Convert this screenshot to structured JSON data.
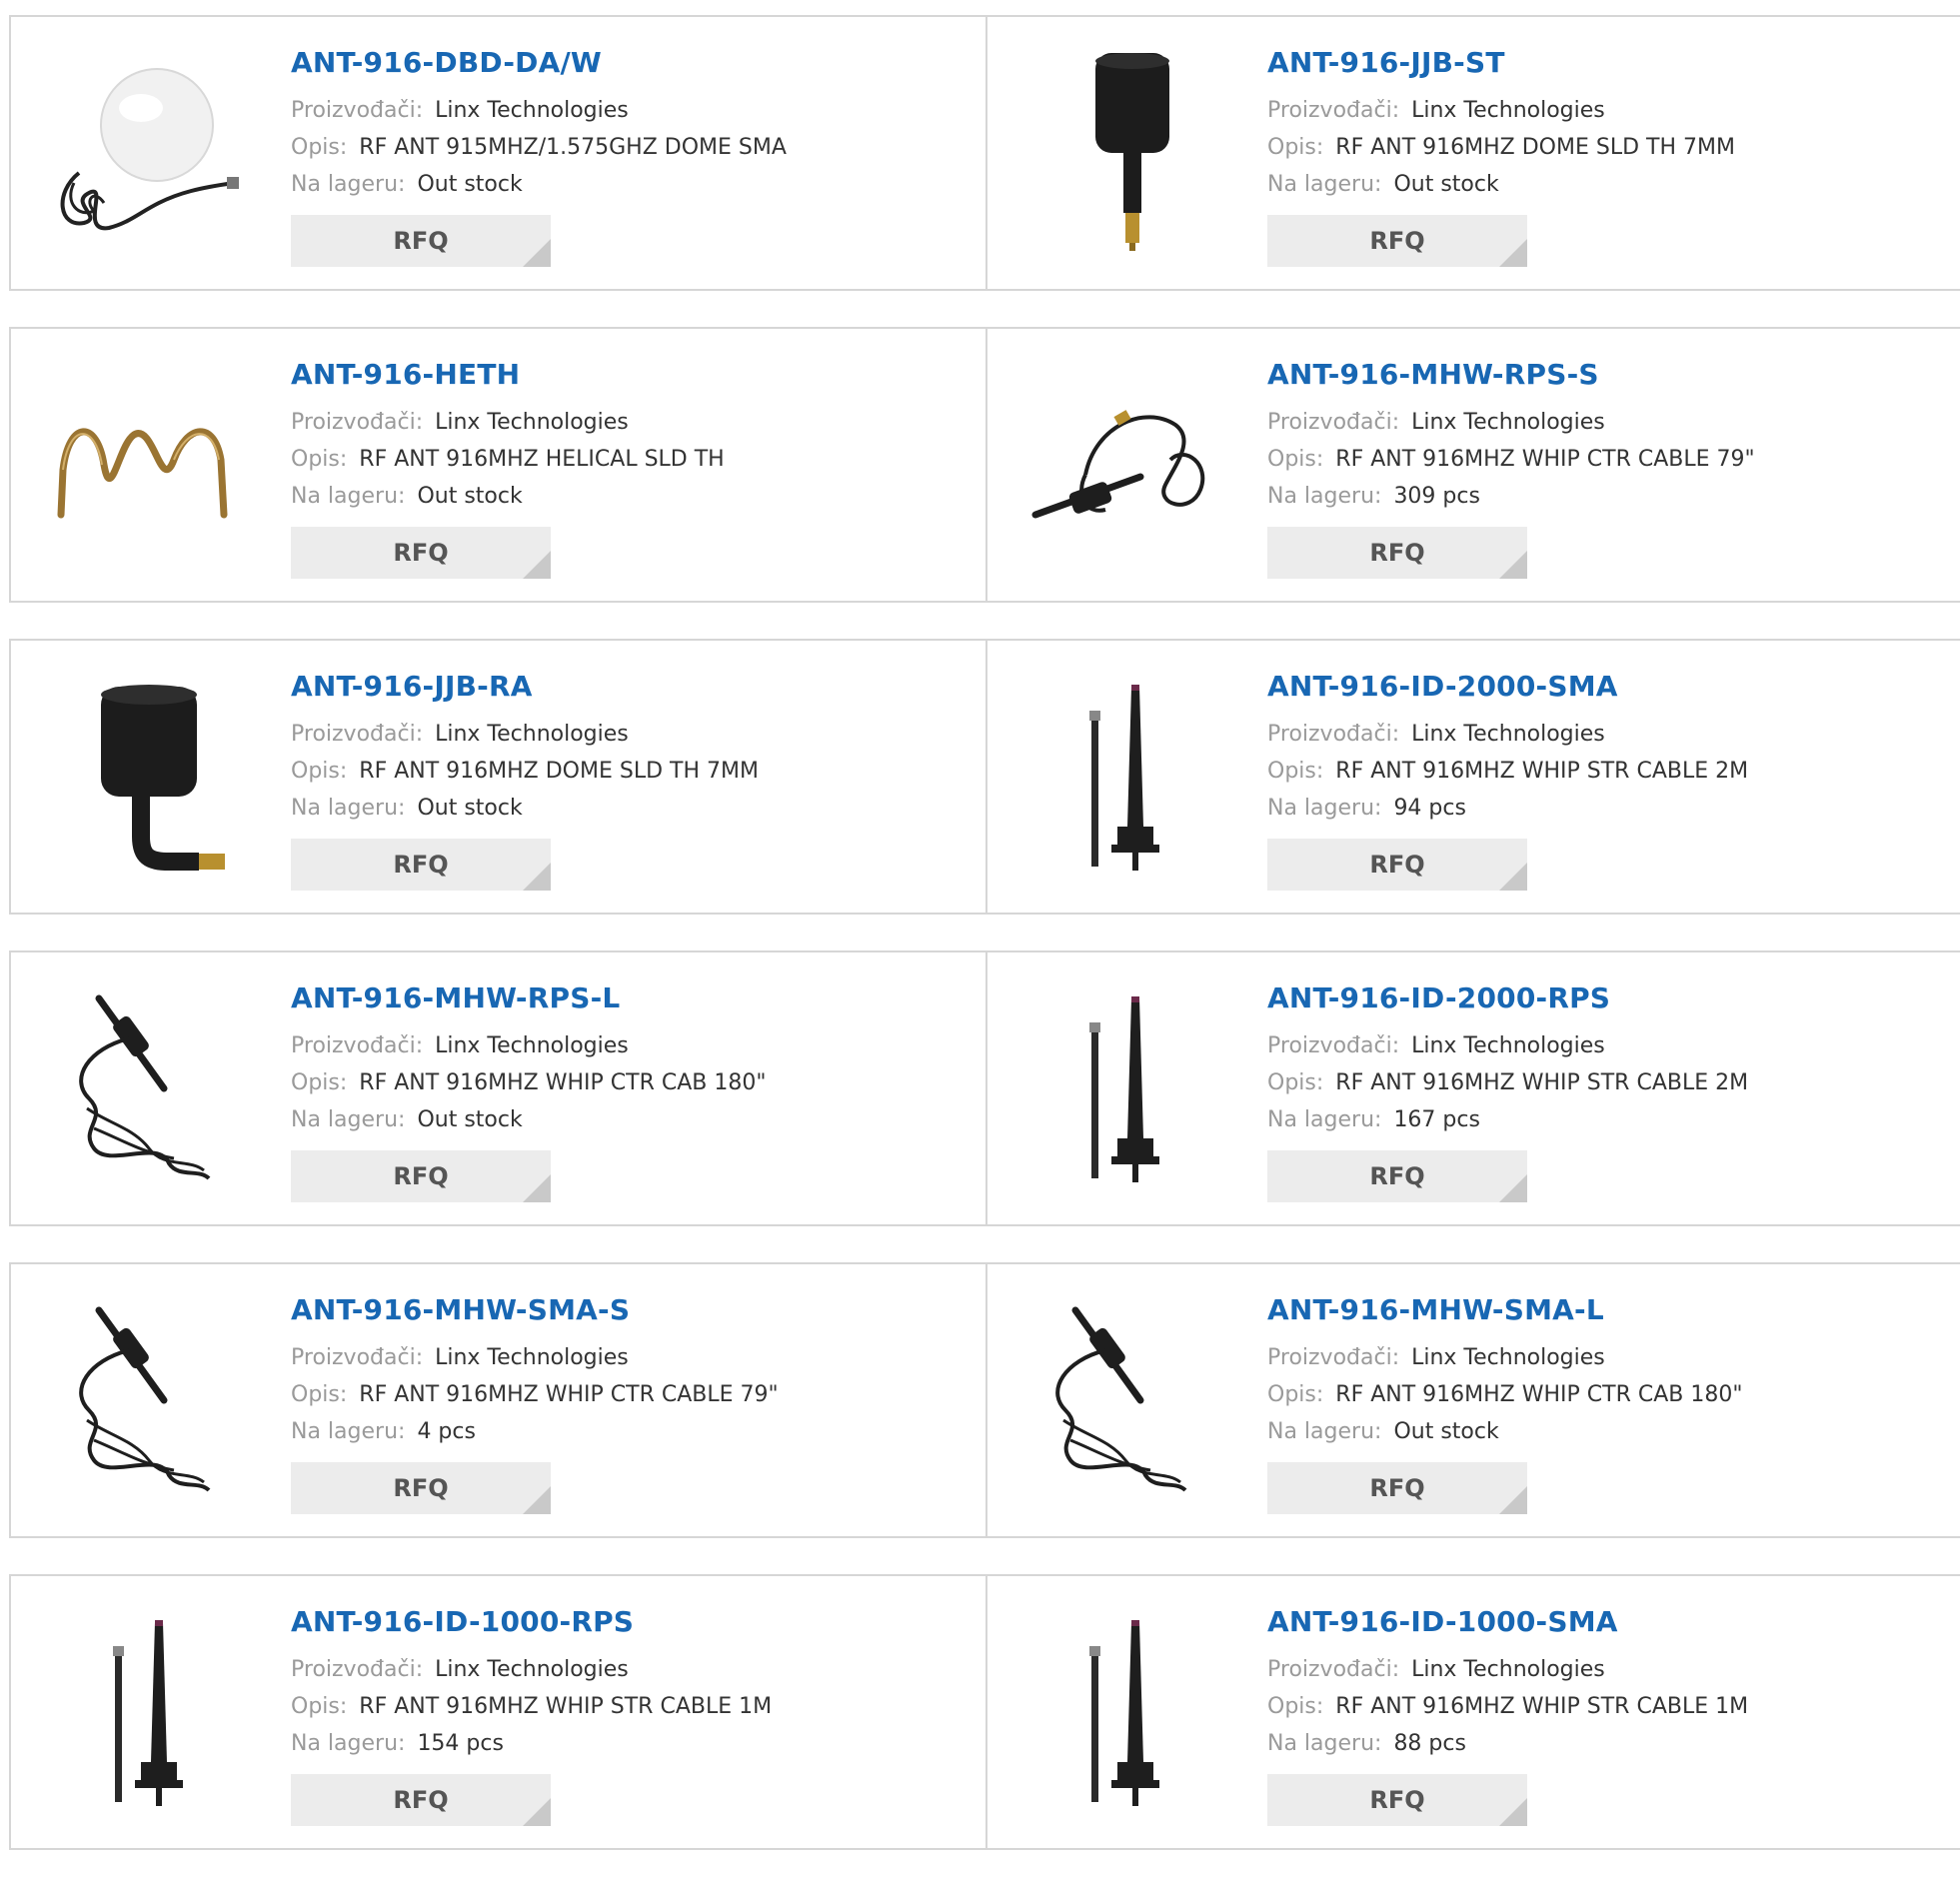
{
  "labels": {
    "manufacturer": "Proizvođači:",
    "description": "Opis:",
    "stock": "Na lageru:",
    "rfq": "RFQ"
  },
  "products": [
    {
      "name": "ANT-916-DBD-DA/W",
      "manufacturer": "Linx Technologies",
      "description": "RF ANT 915MHZ/1.575GHZ DOME SMA",
      "stock": "Out stock",
      "image": "dome-antenna-white"
    },
    {
      "name": "ANT-916-JJB-ST",
      "manufacturer": "Linx Technologies",
      "description": "RF ANT 916MHZ DOME SLD TH 7MM",
      "stock": "Out stock",
      "image": "dome-antenna-straight"
    },
    {
      "name": "ANT-916-HETH",
      "manufacturer": "Linx Technologies",
      "description": "RF ANT 916MHZ HELICAL SLD TH",
      "stock": "Out stock",
      "image": "helical-antenna"
    },
    {
      "name": "ANT-916-MHW-RPS-S",
      "manufacturer": "Linx Technologies",
      "description": "RF ANT 916MHZ WHIP CTR CABLE 79\"",
      "stock": "309 pcs",
      "image": "whip-cable-antenna"
    },
    {
      "name": "ANT-916-JJB-RA",
      "manufacturer": "Linx Technologies",
      "description": "RF ANT 916MHZ DOME SLD TH 7MM",
      "stock": "Out stock",
      "image": "dome-antenna-right-angle"
    },
    {
      "name": "ANT-916-ID-2000-SMA",
      "manufacturer": "Linx Technologies",
      "description": "RF ANT 916MHZ WHIP STR CABLE 2M",
      "stock": "94 pcs",
      "image": "whip-mount-antenna"
    },
    {
      "name": "ANT-916-MHW-RPS-L",
      "manufacturer": "Linx Technologies",
      "description": "RF ANT 916MHZ WHIP CTR CAB 180\"",
      "stock": "Out stock",
      "image": "whip-coil-antenna"
    },
    {
      "name": "ANT-916-ID-2000-RPS",
      "manufacturer": "Linx Technologies",
      "description": "RF ANT 916MHZ WHIP STR CABLE 2M",
      "stock": "167 pcs",
      "image": "whip-mount-antenna"
    },
    {
      "name": "ANT-916-MHW-SMA-S",
      "manufacturer": "Linx Technologies",
      "description": "RF ANT 916MHZ WHIP CTR CABLE 79\"",
      "stock": "4 pcs",
      "image": "whip-coil-antenna"
    },
    {
      "name": "ANT-916-MHW-SMA-L",
      "manufacturer": "Linx Technologies",
      "description": "RF ANT 916MHZ WHIP CTR CAB 180\"",
      "stock": "Out stock",
      "image": "whip-coil-antenna"
    },
    {
      "name": "ANT-916-ID-1000-RPS",
      "manufacturer": "Linx Technologies",
      "description": "RF ANT 916MHZ WHIP STR CABLE 1M",
      "stock": "154 pcs",
      "image": "whip-mount-antenna"
    },
    {
      "name": "ANT-916-ID-1000-SMA",
      "manufacturer": "Linx Technologies",
      "description": "RF ANT 916MHZ WHIP STR CABLE 1M",
      "stock": "88 pcs",
      "image": "whip-mount-antenna"
    }
  ]
}
